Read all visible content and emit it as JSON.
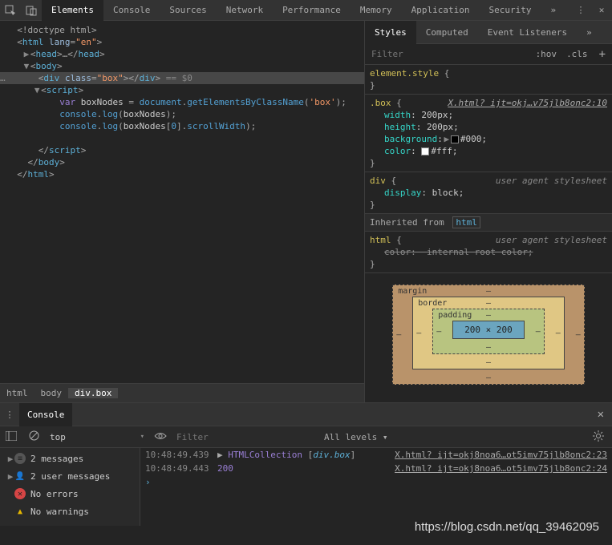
{
  "topTabs": {
    "t0": "Elements",
    "t1": "Console",
    "t2": "Sources",
    "t3": "Network",
    "t4": "Performance",
    "t5": "Memory",
    "t6": "Application",
    "t7": "Security",
    "more": "»"
  },
  "dom": {
    "l0": "<!doctype html>",
    "l1_a": "<",
    "l1_b": "html",
    "l1_c": " lang",
    "l1_d": "=",
    "l1_e": "\"en\"",
    "l1_f": ">",
    "l2_a": "<",
    "l2_b": "head",
    "l2_c": ">",
    "l2_d": "…",
    "l2_e": "</",
    "l2_f": "head",
    "l2_g": ">",
    "l3_a": "<",
    "l3_b": "body",
    "l3_c": ">",
    "l4_a": "<",
    "l4_b": "div",
    "l4_c": " class",
    "l4_d": "=",
    "l4_e": "\"box\"",
    "l4_f": ">",
    "l4_g": "</",
    "l4_h": "div",
    "l4_i": ">",
    "l4_j": " == $0",
    "l5_a": "<",
    "l5_b": "script",
    "l5_c": ">",
    "s1_a": "var",
    "s1_b": " boxNodes ",
    "s1_c": "= ",
    "s1_d": "document",
    "s1_e": ".",
    "s1_f": "getElementsByClassName",
    "s1_g": "(",
    "s1_h": "'box'",
    "s1_i": ");",
    "s2_a": "console",
    "s2_b": ".",
    "s2_c": "log",
    "s2_d": "(",
    "s2_e": "boxNodes",
    "s2_f": ");",
    "s3_a": "console",
    "s3_b": ".",
    "s3_c": "log",
    "s3_d": "(",
    "s3_e": "boxNodes",
    "s3_f": "[",
    "s3_g": "0",
    "s3_h": "].",
    "s3_i": "scrollWidth",
    "s3_j": ");",
    "l6_a": "</",
    "l6_b": "script",
    "l6_c": ">",
    "l7_a": "</",
    "l7_b": "body",
    "l7_c": ">",
    "l8_a": "</",
    "l8_b": "html",
    "l8_c": ">"
  },
  "crumbs": {
    "c0": "html",
    "c1": "body",
    "c2": "div.box"
  },
  "stylesTabs": {
    "t0": "Styles",
    "t1": "Computed",
    "t2": "Event Listeners",
    "more": "»"
  },
  "filter": {
    "placeholder": "Filter",
    "hov": ":hov",
    "cls": ".cls"
  },
  "rules": {
    "r0_sel": "element.style ",
    "r0_b": "{",
    "r0_e": "}",
    "r1_sel": ".box ",
    "r1_b": "{",
    "r1_link": "X.html? ijt=okj…v75jlb8onc2:10",
    "r1_p0": "width",
    "r1_v0": ": 200px;",
    "r1_p1": "height",
    "r1_v1": ": 200px;",
    "r1_p2": "background",
    "r1_v2": ":",
    "r1_v2b": "#000;",
    "r1_p3": "color",
    "r1_v3": ":",
    "r1_v3b": "#fff;",
    "r1_e": "}",
    "r2_sel": "div ",
    "r2_b": "{",
    "r2_ua": "user agent stylesheet",
    "r2_p0": "display",
    "r2_v0": ": block;",
    "r2_e": "}",
    "inh": "Inherited from ",
    "inh_tag": "html",
    "r3_sel": "html ",
    "r3_b": "{",
    "r3_ua": "user agent stylesheet",
    "r3_p0": "color",
    "r3_v0": ":  internal root color;",
    "r3_e": "}"
  },
  "bm": {
    "margin": "margin",
    "border": "border",
    "padding": "padding",
    "content": "200 × 200",
    "dash": "–"
  },
  "console": {
    "tab": "Console",
    "ctx": "top",
    "filterPh": "Filter",
    "levels": "All levels ▾",
    "chev": "▾",
    "side": {
      "m0": "2 messages",
      "m1": "2 user messages",
      "m2": "No errors",
      "m3": "No warnings"
    },
    "log0_ts": "10:48:49.439",
    "log0_a": "▶ ",
    "log0_b": "HTMLCollection ",
    "log0_c": "[",
    "log0_d": "div.box",
    "log0_e": "]",
    "log0_link": "X.html? ijt=okj8noa6…ot5imv75jlb8onc2:23",
    "log1_ts": "10:48:49.443",
    "log1_v": "200",
    "log1_link": "X.html? ijt=okj8noa6…ot5imv75jlb8onc2:24",
    "prompt": "›"
  },
  "colors": {
    "black": "#000",
    "white": "#fff"
  },
  "watermark": "https://blog.csdn.net/qq_39462095"
}
